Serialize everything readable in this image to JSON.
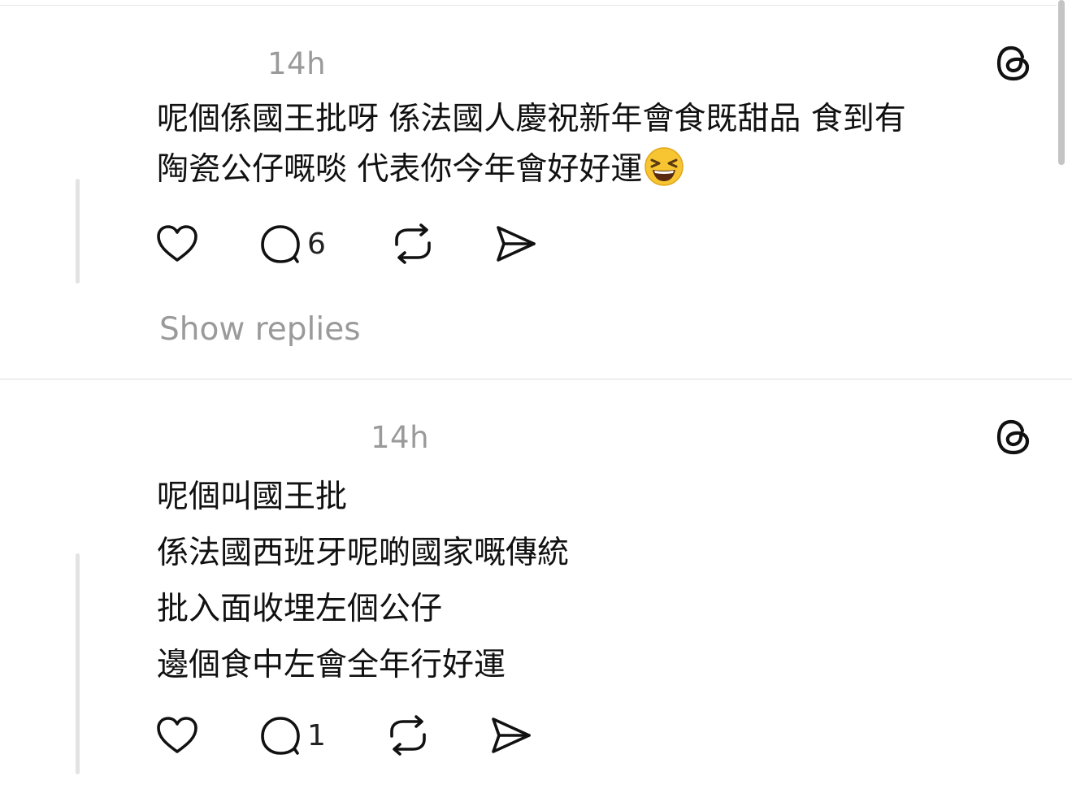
{
  "posts": [
    {
      "timestamp": "14h",
      "lines": [
        "呢個係國王批呀 係法國人慶祝新年會食既甜品 食到有",
        "陶瓷公仔嘅啖 代表你今年會好好運"
      ],
      "emoji": "grinning-squinting-face",
      "reply_count": "6",
      "show_replies_label": "Show replies"
    },
    {
      "timestamp": "14h",
      "lines": [
        "呢個叫國王批",
        "係法國西班牙呢啲國家嘅傳統",
        "批入面收埋左個公仔",
        "邊個食中左會全年行好運"
      ],
      "reply_count": "1"
    }
  ],
  "icons": {
    "like": "heart-icon",
    "reply": "comment-icon",
    "repost": "repost-icon",
    "share": "send-icon",
    "brand": "threads-logo-icon"
  },
  "colors": {
    "text": "#111111",
    "muted": "#9a9a9a",
    "divider": "#dcdcdc",
    "thread_line": "#e3e3e3"
  }
}
